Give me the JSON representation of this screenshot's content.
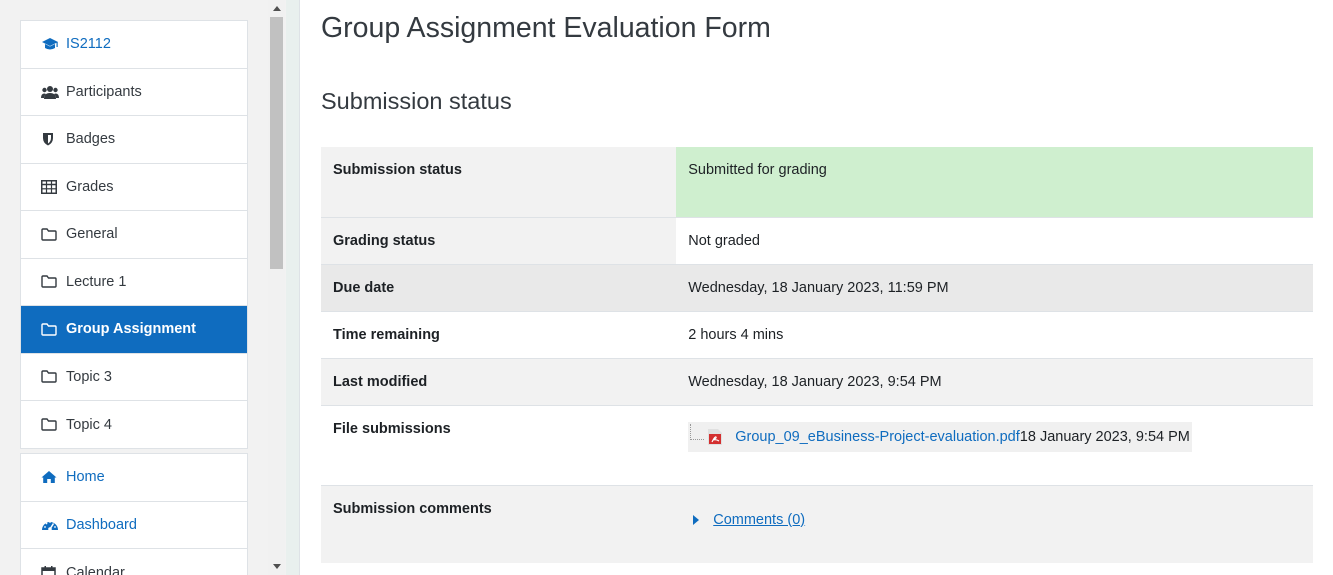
{
  "sidebar": {
    "course_items": [
      {
        "label": "IS2112",
        "icon": "graduation-cap-icon"
      },
      {
        "label": "Participants",
        "icon": "users-icon"
      },
      {
        "label": "Badges",
        "icon": "shield-icon"
      },
      {
        "label": "Grades",
        "icon": "table-icon"
      },
      {
        "label": "General",
        "icon": "folder-icon"
      },
      {
        "label": "Lecture 1",
        "icon": "folder-icon"
      },
      {
        "label": "Group Assignment",
        "icon": "folder-icon"
      },
      {
        "label": "Topic 3",
        "icon": "folder-icon"
      },
      {
        "label": "Topic 4",
        "icon": "folder-icon"
      }
    ],
    "site_items": [
      {
        "label": "Home",
        "icon": "home-icon"
      },
      {
        "label": "Dashboard",
        "icon": "dashboard-icon"
      },
      {
        "label": "Calendar",
        "icon": "calendar-icon"
      }
    ],
    "active_label": "Group Assignment"
  },
  "main": {
    "page_title": "Group Assignment Evaluation Form",
    "section_title": "Submission status",
    "rows": {
      "submission_status": {
        "label": "Submission status",
        "value": "Submitted for grading"
      },
      "grading_status": {
        "label": "Grading status",
        "value": "Not graded"
      },
      "due_date": {
        "label": "Due date",
        "value": "Wednesday, 18 January 2023, 11:59 PM"
      },
      "time_remaining": {
        "label": "Time remaining",
        "value": "2 hours 4 mins"
      },
      "last_modified": {
        "label": "Last modified",
        "value": "Wednesday, 18 January 2023, 9:54 PM"
      },
      "file_submissions": {
        "label": "File submissions",
        "file_name": "Group_09_eBusiness-Project-evaluation.pdf",
        "file_date": "18 January 2023, 9:54 PM"
      },
      "submission_comments": {
        "label": "Submission comments",
        "link": "Comments (0)"
      }
    }
  },
  "colors": {
    "accent": "#0f6cbf",
    "submitted_bg": "#cfefcf"
  }
}
